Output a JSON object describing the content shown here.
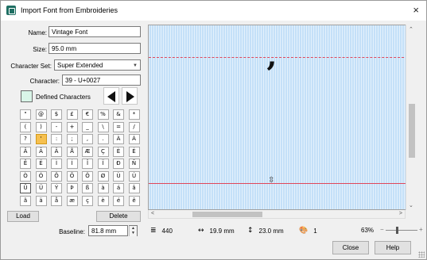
{
  "window": {
    "title": "Import Font from Embroideries",
    "close_glyph": "×"
  },
  "fields": {
    "name_label": "Name:",
    "name_value": "Vintage Font",
    "size_label": "Size:",
    "size_value": "95.0 mm",
    "charset_label": "Character Set:",
    "charset_value": "Super Extended",
    "character_label": "Character:",
    "character_value": "39 - U+0027"
  },
  "defined_chars_label": "Defined Characters",
  "char_grid": [
    [
      "\"",
      "@",
      "$",
      "£",
      "€",
      "%",
      "&",
      "*"
    ],
    [
      "(",
      ")",
      "-",
      "+",
      "_",
      "\\",
      "=",
      "/"
    ],
    [
      "?",
      "'",
      ":",
      ";",
      ",",
      ".",
      "À",
      "Á"
    ],
    [
      "Â",
      "Ã",
      "Ä",
      "Å",
      "Æ",
      "Ç",
      "È",
      "É"
    ],
    [
      "Ê",
      "Ë",
      "Ì",
      "Í",
      "Î",
      "Ï",
      "Ð",
      "Ñ"
    ],
    [
      "Ò",
      "Ó",
      "Ô",
      "Õ",
      "Ö",
      "Ø",
      "Ù",
      "Ú"
    ],
    [
      "Û",
      "Ü",
      "Ý",
      "Þ",
      "ß",
      "à",
      "á",
      "â"
    ],
    [
      "ã",
      "ä",
      "å",
      "æ",
      "ç",
      "è",
      "é",
      "ê"
    ]
  ],
  "buttons": {
    "load": "Load",
    "delete": "Delete",
    "close": "Close",
    "help": "Help"
  },
  "baseline": {
    "label": "Baseline:",
    "value": "81.8 mm"
  },
  "preview": {
    "glyph": "’"
  },
  "status": {
    "stitch_count": "440",
    "width": "19.9 mm",
    "height": "23.0 mm",
    "colors": "1",
    "zoom": "63%",
    "zoom_minus": "−",
    "zoom_plus": "+"
  },
  "icons": {
    "stitches": "≣",
    "width": "↔",
    "height": "↕",
    "palette": "🎨",
    "up": "⌃",
    "down": "⌄",
    "left": "<",
    "right": ">"
  },
  "accent_colors": {
    "selection": "#f6c04f",
    "guide": "#e0475a",
    "canvas": "#c4e0f8",
    "defined": "#d9f5e8"
  }
}
